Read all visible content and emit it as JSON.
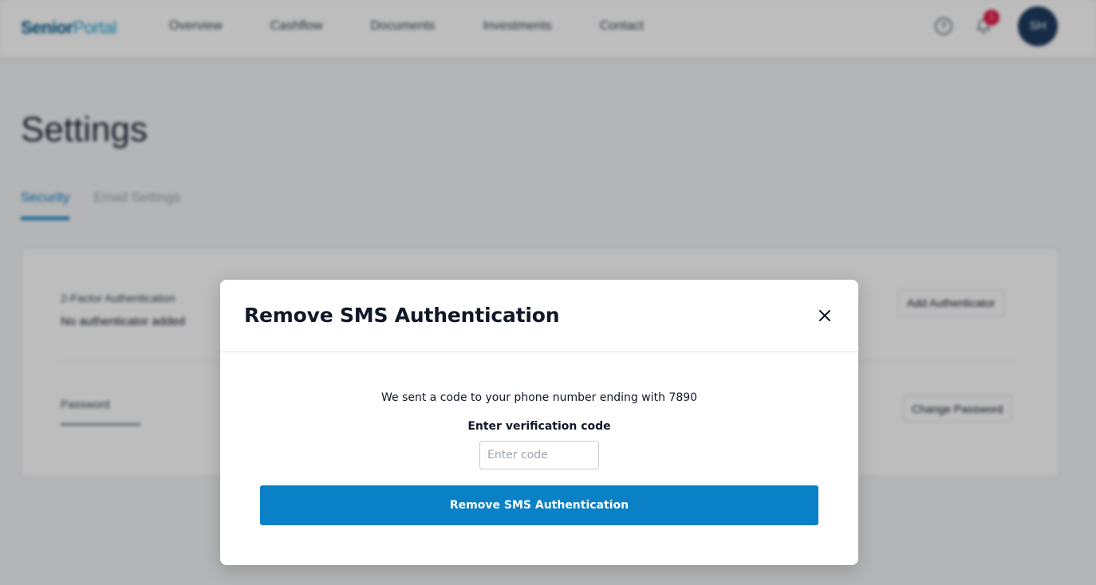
{
  "header": {
    "logo_main": "Senior",
    "logo_accent": "Portal",
    "nav": [
      "Overview",
      "Cashflow",
      "Documents",
      "Investments",
      "Contact"
    ],
    "help_icon": "question-circle-icon",
    "bell_icon": "bell-icon",
    "notification_count": "1",
    "avatar_initials": "SH"
  },
  "page": {
    "title": "Settings",
    "tabs": [
      "Security",
      "Email Settings"
    ],
    "active_tab": "Security"
  },
  "security": {
    "two_factor_label": "2-Factor Authentication",
    "two_factor_value": "No authenticator added",
    "add_authenticator_label": "Add Authenticator",
    "password_label": "Password",
    "password_value": "••••••••••••••••••••••••••",
    "change_password_label": "Change Password"
  },
  "modal": {
    "title": "Remove SMS Authentication",
    "close_icon": "close-icon",
    "sent_message": "We sent a code to your phone number ending with 7890",
    "code_label": "Enter verification code",
    "code_placeholder": "Enter code",
    "code_value": "",
    "submit_label": "Remove SMS Authentication"
  },
  "colors": {
    "primary": "#0a80c6",
    "overlay": "rgba(0,0,0,0.26)",
    "badge": "#e11d48",
    "avatar": "#1e3a5f"
  }
}
